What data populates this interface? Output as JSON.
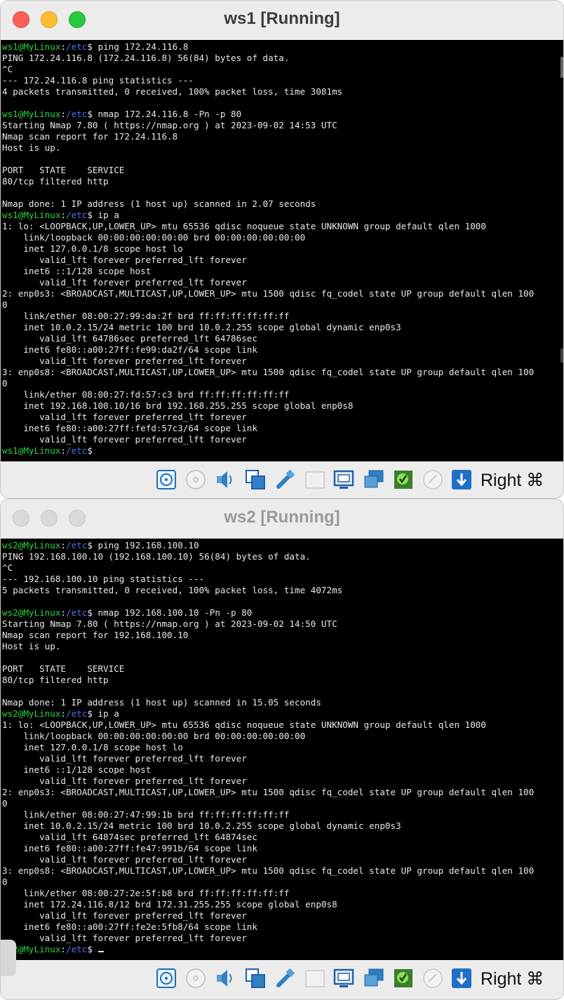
{
  "windows": [
    {
      "title": "ws1 [Running]",
      "prompt_user": "ws1@MyLinux",
      "prompt_dir": "/etc",
      "lines": [
        [
          "ws1@MyLinux:/etc$ ",
          "ping 172.24.116.8"
        ],
        "PING 172.24.116.8 (172.24.116.8) 56(84) bytes of data.",
        "^C",
        "--- 172.24.116.8 ping statistics ---",
        "4 packets transmitted, 0 received, 100% packet loss, time 3081ms",
        "",
        [
          "ws1@MyLinux:/etc$ ",
          "nmap 172.24.116.8 -Pn -p 80"
        ],
        "Starting Nmap 7.80 ( https://nmap.org ) at 2023-09-02 14:53 UTC",
        "Nmap scan report for 172.24.116.8",
        "Host is up.",
        "",
        "PORT   STATE    SERVICE",
        "80/tcp filtered http",
        "",
        "Nmap done: 1 IP address (1 host up) scanned in 2.07 seconds",
        [
          "ws1@MyLinux:/etc$ ",
          "ip a"
        ],
        "1: lo: <LOOPBACK,UP,LOWER_UP> mtu 65536 qdisc noqueue state UNKNOWN group default qlen 1000",
        "    link/loopback 00:00:00:00:00:00 brd 00:00:00:00:00:00",
        "    inet 127.0.0.1/8 scope host lo",
        "       valid_lft forever preferred_lft forever",
        "    inet6 ::1/128 scope host",
        "       valid_lft forever preferred_lft forever",
        "2: enp0s3: <BROADCAST,MULTICAST,UP,LOWER_UP> mtu 1500 qdisc fq_codel state UP group default qlen 100",
        "0",
        "    link/ether 08:00:27:99:da:2f brd ff:ff:ff:ff:ff:ff",
        "    inet 10.0.2.15/24 metric 100 brd 10.0.2.255 scope global dynamic enp0s3",
        "       valid_lft 64786sec preferred_lft 64786sec",
        "    inet6 fe80::a00:27ff:fe99:da2f/64 scope link",
        "       valid_lft forever preferred_lft forever",
        "3: enp0s8: <BROADCAST,MULTICAST,UP,LOWER_UP> mtu 1500 qdisc fq_codel state UP group default qlen 100",
        "0",
        "    link/ether 08:00:27:fd:57:c3 brd ff:ff:ff:ff:ff:ff",
        "    inet 192.168.100.10/16 brd 192.168.255.255 scope global enp0s8",
        "       valid_lft forever preferred_lft forever",
        "    inet6 fe80::a00:27ff:fefd:57c3/64 scope link",
        "       valid_lft forever preferred_lft forever",
        [
          "ws1@MyLinux:/etc$ ",
          ""
        ]
      ],
      "host_key": "Right ⌘"
    },
    {
      "title": "ws2 [Running]",
      "prompt_user": "ws2@MyLinux",
      "prompt_dir": "/etc",
      "lines": [
        [
          "ws2@MyLinux:/etc$ ",
          "ping 192.168.100.10"
        ],
        "PING 192.168.100.10 (192.168.100.10) 56(84) bytes of data.",
        "^C",
        "--- 192.168.100.10 ping statistics ---",
        "5 packets transmitted, 0 received, 100% packet loss, time 4072ms",
        "",
        [
          "ws2@MyLinux:/etc$ ",
          "nmap 192.168.100.10 -Pn -p 80"
        ],
        "Starting Nmap 7.80 ( https://nmap.org ) at 2023-09-02 14:50 UTC",
        "Nmap scan report for 192.168.100.10",
        "Host is up.",
        "",
        "PORT   STATE    SERVICE",
        "80/tcp filtered http",
        "",
        "Nmap done: 1 IP address (1 host up) scanned in 15.05 seconds",
        [
          "ws2@MyLinux:/etc$ ",
          "ip a"
        ],
        "1: lo: <LOOPBACK,UP,LOWER_UP> mtu 65536 qdisc noqueue state UNKNOWN group default qlen 1000",
        "    link/loopback 00:00:00:00:00:00 brd 00:00:00:00:00:00",
        "    inet 127.0.0.1/8 scope host lo",
        "       valid_lft forever preferred_lft forever",
        "    inet6 ::1/128 scope host",
        "       valid_lft forever preferred_lft forever",
        "2: enp0s3: <BROADCAST,MULTICAST,UP,LOWER_UP> mtu 1500 qdisc fq_codel state UP group default qlen 100",
        "0",
        "    link/ether 08:00:27:47:99:1b brd ff:ff:ff:ff:ff:ff",
        "    inet 10.0.2.15/24 metric 100 brd 10.0.2.255 scope global dynamic enp0s3",
        "       valid_lft 64874sec preferred_lft 64874sec",
        "    inet6 fe80::a00:27ff:fe47:991b/64 scope link",
        "       valid_lft forever preferred_lft forever",
        "3: enp0s8: <BROADCAST,MULTICAST,UP,LOWER_UP> mtu 1500 qdisc fq_codel state UP group default qlen 100",
        "0",
        "    link/ether 08:00:27:2e:5f:b8 brd ff:ff:ff:ff:ff:ff",
        "    inet 172.24.116.8/12 brd 172.31.255.255 scope global enp0s8",
        "       valid_lft forever preferred_lft forever",
        "    inet6 fe80::a00:27ff:fe2e:5fb8/64 scope link",
        "       valid_lft forever preferred_lft forever",
        [
          "ws2@MyLinux:/etc$ ",
          ""
        ]
      ],
      "host_key": "Right ⌘"
    }
  ],
  "statusbar_icons": [
    "hard-disk-icon",
    "optical-drive-icon",
    "audio-icon",
    "network-icon",
    "usb-icon",
    "shared-folder-icon",
    "display-icon",
    "screen-capture-icon",
    "recording-icon",
    "mouse-integration-icon",
    "host-key-arrow-icon"
  ],
  "colors": {
    "prompt_user": "#29d33a",
    "prompt_dir": "#4f6fe8",
    "terminal_bg": "#000000",
    "terminal_fg": "#e8e8e8"
  }
}
